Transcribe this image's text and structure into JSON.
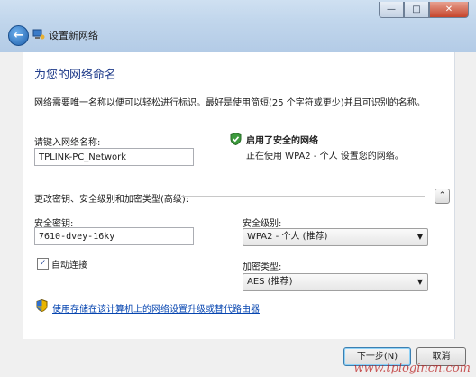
{
  "window": {
    "title": "设置新网络",
    "controls": {
      "minimize": "—",
      "maximize": "□",
      "close": "✕"
    }
  },
  "page": {
    "heading": "为您的网络命名",
    "description": "网络需要唯一名称以便可以轻松进行标识。最好是使用简短(25 个字符或更少)并且可识别的名称。"
  },
  "network_name": {
    "label": "请键入网络名称:",
    "value": "TPLINK-PC_Network"
  },
  "security_status": {
    "title": "启用了安全的网络",
    "subtitle": "正在使用 WPA2 - 个人 设置您的网络。"
  },
  "advanced": {
    "label": "更改密钥、安全级别和加密类型(高级):",
    "collapse_symbol": "⌃"
  },
  "security_key": {
    "label": "安全密钥:",
    "value": "7610-dvey-16ky"
  },
  "security_level": {
    "label": "安全级别:",
    "selected": "WPA2 - 个人 (推荐)"
  },
  "auto_connect": {
    "label": "自动连接",
    "checked": true
  },
  "encryption_type": {
    "label": "加密类型:",
    "selected": "AES (推荐)"
  },
  "upgrade_link": "使用存储在该计算机上的网络设置升级或替代路由器",
  "buttons": {
    "next": "下一步(N)",
    "cancel": "取消"
  },
  "watermark": "www.tplogincn.com"
}
